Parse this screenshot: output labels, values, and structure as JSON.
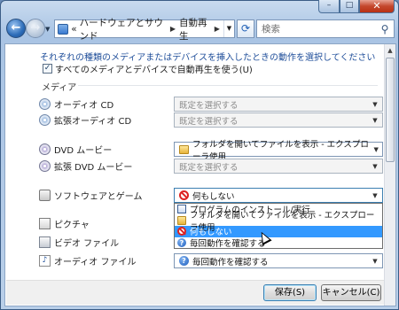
{
  "window": {
    "minimize": "–",
    "maximize": "□",
    "close": "✕"
  },
  "nav": {
    "back": "←",
    "forward": "→",
    "breadcrumb_prefix": "«",
    "breadcrumb": [
      "ハードウェアとサウンド",
      "自動再生"
    ],
    "refresh": "⟳",
    "search_placeholder": "検索",
    "search_icon": "search-icon"
  },
  "header": {
    "instruction": "それぞれの種類のメディアまたはデバイスを挿入したときの動作を選択してください",
    "use_all_label": "すべてのメディアとデバイスで自動再生を使う(U)",
    "use_all_checked": true
  },
  "section": {
    "media_label": "メディア"
  },
  "rows": [
    {
      "label": "オーディオ CD",
      "value": "既定を選択する",
      "icon": "cd-icon",
      "enabled": false
    },
    {
      "label": "拡張オーディオ CD",
      "value": "既定を選択する",
      "icon": "cd-icon",
      "enabled": false
    },
    {
      "label": "DVD ムービー",
      "value": "フォルダを開いてファイルを表示 - エクスプローラ使用",
      "icon": "dvd-icon",
      "enabled": true
    },
    {
      "label": "拡張 DVD ムービー",
      "value": "既定を選択する",
      "icon": "dvd-icon",
      "enabled": false
    },
    {
      "label": "ソフトウェアとゲーム",
      "value": "何もしない",
      "icon": "software-icon",
      "enabled": true
    },
    {
      "label": "ピクチャ",
      "icon": "picture-icon"
    },
    {
      "label": "ビデオ ファイル",
      "icon": "video-icon"
    },
    {
      "label": "オーディオ ファイル",
      "value": "毎回動作を確認する",
      "icon": "audio-icon",
      "enabled": true
    }
  ],
  "dropdown": {
    "options": [
      "プログラムのインストール/実行",
      "フォルダを開いてファイルを表示 - エクスプローラ使用",
      "何もしない",
      "毎回動作を確認する"
    ],
    "selected": "何もしない"
  },
  "footer": {
    "save_label": "保存(S)",
    "cancel_label": "キャンセル(C)"
  }
}
